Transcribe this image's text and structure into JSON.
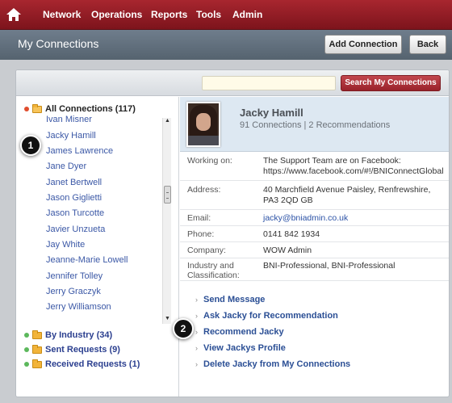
{
  "nav": {
    "home_icon": "home-icon",
    "items": [
      "Network",
      "Operations",
      "Reports",
      "Tools",
      "Admin"
    ]
  },
  "header": {
    "title": "My Connections",
    "add_button": "Add Connection",
    "back_button": "Back"
  },
  "search": {
    "placeholder": "",
    "button": "Search My Connections"
  },
  "tree": {
    "all_connections": "All Connections (117)",
    "connections": [
      "Ivan Misner",
      "Jacky Hamill",
      "James Lawrence",
      "Jane Dyer",
      "Janet Bertwell",
      "Jason Giglietti",
      "Jason Turcotte",
      "Javier Unzueta",
      "Jay White",
      "Jeanne-Marie Lowell",
      "Jennifer Tolley",
      "Jerry Graczyk",
      "Jerry Williamson"
    ],
    "by_industry": "By Industry (34)",
    "sent_requests": "Sent Requests (9)",
    "received_requests": "Received Requests (1)"
  },
  "profile": {
    "name": "Jacky Hamill",
    "summary": "91 Connections | 2 Recommendations",
    "fields": [
      {
        "label": "Working on:",
        "value": "The Support Team are on Facebook: https://www.facebook.com/#!/BNIConnectGlobal"
      },
      {
        "label": "Address:",
        "value": "40 Marchfield Avenue Paisley, Renfrewshire, PA3 2QD  GB"
      },
      {
        "label": "Email:",
        "value": "jacky@bniadmin.co.uk"
      },
      {
        "label": "Phone:",
        "value": "0141 842 1934"
      },
      {
        "label": "Company:",
        "value": "WOW Admin"
      },
      {
        "label": "Industry and Classification:",
        "value": "BNI-Professional, BNI-Professional"
      }
    ],
    "actions": [
      "Send Message",
      "Ask Jacky for Recommendation",
      "Recommend Jacky",
      "View Jackys Profile",
      "Delete Jacky from My Connections"
    ]
  },
  "callouts": [
    "1",
    "2"
  ],
  "colors": {
    "nav_bg": "#8f1d25",
    "subheader_bg": "#616f7d",
    "search_button": "#a8303a",
    "link": "#3b58a6"
  }
}
